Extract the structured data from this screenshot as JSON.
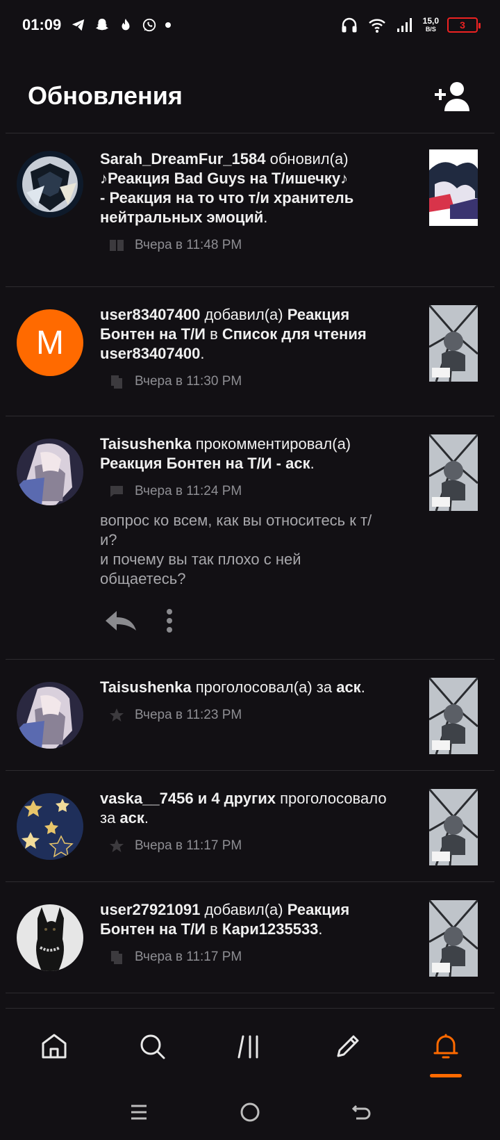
{
  "status_bar": {
    "time": "01:09",
    "app_icons": [
      "telegram-icon",
      "snapchat-icon",
      "flame-icon",
      "whatsapp-icon"
    ],
    "net_speed": "15,0",
    "net_unit": "B/S",
    "battery": "3"
  },
  "header": {
    "title": "Обновления",
    "add_icon": "add-person-icon"
  },
  "feed": [
    {
      "user": "Sarah_DreamFur_1584",
      "action": " обновил(а)",
      "line2": "♪Реакция Bad Guys на Т/ишечку♪",
      "line3": "- Реакция на то что т/и хранитель",
      "line4": "нейтральных эмоций",
      "line4_tail": ".",
      "time": "Вчера в 11:48 PM",
      "meta_icon": "book-icon"
    },
    {
      "user": "user83407400",
      "action": " добавил(а) ",
      "story": "Реакция",
      "line2": "Бонтен на Т/И",
      "line2_mid": " в ",
      "line2_list": "Список для чтения",
      "line3": "user83407400",
      "line3_tail": ".",
      "avatar_letter": "M",
      "time": "Вчера в 11:30 PM",
      "meta_icon": "copy-icon"
    },
    {
      "user": "Taisushenka",
      "action": " прокомментировал(а)",
      "line2": "Реакция Бонтен на Т/И - аск",
      "line2_tail": ".",
      "time": "Вчера в 11:24 PM",
      "meta_icon": "comment-icon",
      "comment": [
        "вопрос ко всем, как вы относитесь к т/",
        "и?",
        "и почему вы так плохо с ней",
        "общаетесь?"
      ]
    },
    {
      "user": "Taisushenka",
      "action": " проголосовал(а) за ",
      "target": "аск",
      "tail": ".",
      "time": "Вчера в 11:23 PM",
      "meta_icon": "star-icon"
    },
    {
      "user": "vaska__7456 и 4 других",
      "action": " проголосовало",
      "line2_pre": "за ",
      "target": "аск",
      "tail": ".",
      "time": "Вчера в 11:17 PM",
      "meta_icon": "star-icon"
    },
    {
      "user": "user27921091",
      "action": " добавил(а) ",
      "story": "Реакция",
      "line2": "Бонтен на Т/И",
      "line2_mid": " в ",
      "line2_list": "Кари1235533",
      "line2_tail": ".",
      "time": "Вчера в 11:17 PM",
      "meta_icon": "copy-icon"
    }
  ],
  "bottom_nav": [
    "home-icon",
    "search-icon",
    "library-icon",
    "write-icon",
    "notifications-icon"
  ],
  "accent_color": "#ff6a00"
}
